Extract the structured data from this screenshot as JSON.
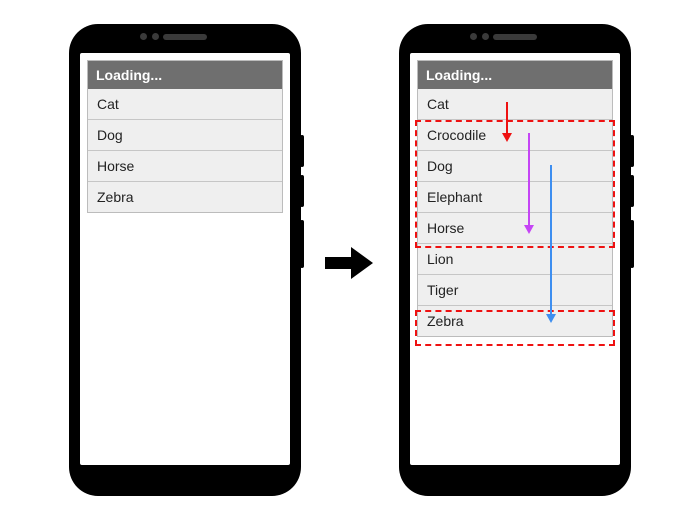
{
  "left": {
    "title": "Loading...",
    "rows": [
      "Cat",
      "Dog",
      "Horse",
      "Zebra"
    ]
  },
  "right": {
    "title": "Loading...",
    "rows": [
      "Cat",
      "Crocodile",
      "Dog",
      "Elephant",
      "Horse",
      "Lion",
      "Tiger",
      "Zebra"
    ]
  },
  "arrows": {
    "red": {
      "from_row": "Cat",
      "to_row": "Crocodile"
    },
    "magenta": {
      "from_row": "Crocodile",
      "to_row": "Horse"
    },
    "blue": {
      "from_row": "Dog",
      "to_row": "Zebra"
    }
  },
  "highlight_groups": [
    [
      "Crocodile",
      "Dog",
      "Elephant",
      "Horse"
    ],
    [
      "Zebra"
    ]
  ],
  "colors": {
    "highlight": "#e01b1b",
    "arrow_red": "#e01b1b",
    "arrow_magenta": "#c545f5",
    "arrow_blue": "#3d8ef0",
    "header": "#6f6f6f"
  }
}
